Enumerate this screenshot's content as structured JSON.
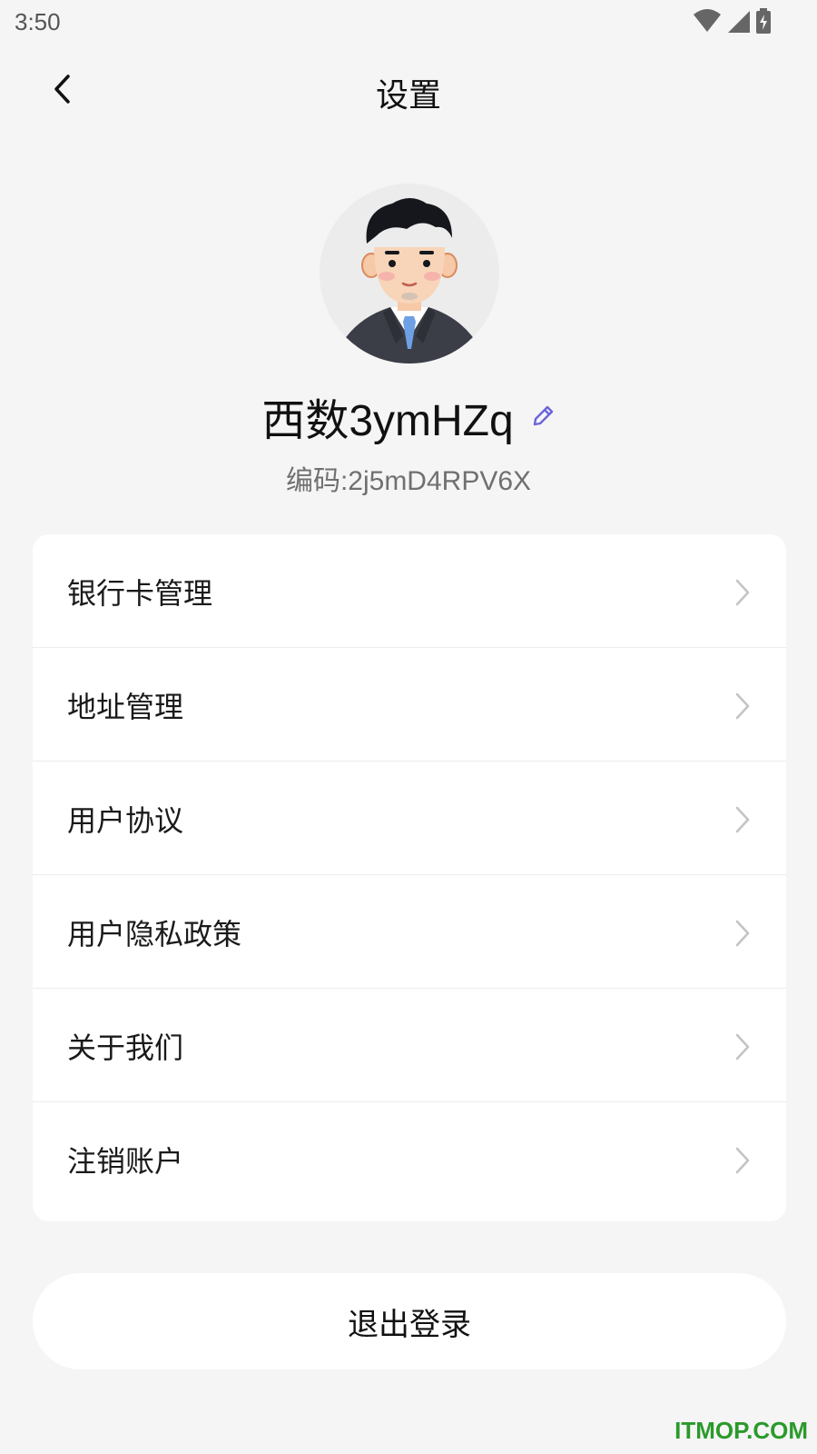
{
  "status_bar": {
    "time": "3:50"
  },
  "nav": {
    "title": "设置"
  },
  "profile": {
    "name": "西数3ymHZq",
    "code": "编码:2j5mD4RPV6X"
  },
  "menu": {
    "items": [
      {
        "label": "银行卡管理"
      },
      {
        "label": "地址管理"
      },
      {
        "label": "用户协议"
      },
      {
        "label": "用户隐私政策"
      },
      {
        "label": "关于我们"
      },
      {
        "label": "注销账户"
      }
    ]
  },
  "logout": {
    "label": "退出登录"
  },
  "watermark": {
    "text": "ITMOP.COM"
  },
  "colors": {
    "background": "#f5f5f5",
    "card": "#ffffff",
    "edit_icon": "#6b63d9",
    "watermark": "#2a9a2a"
  }
}
